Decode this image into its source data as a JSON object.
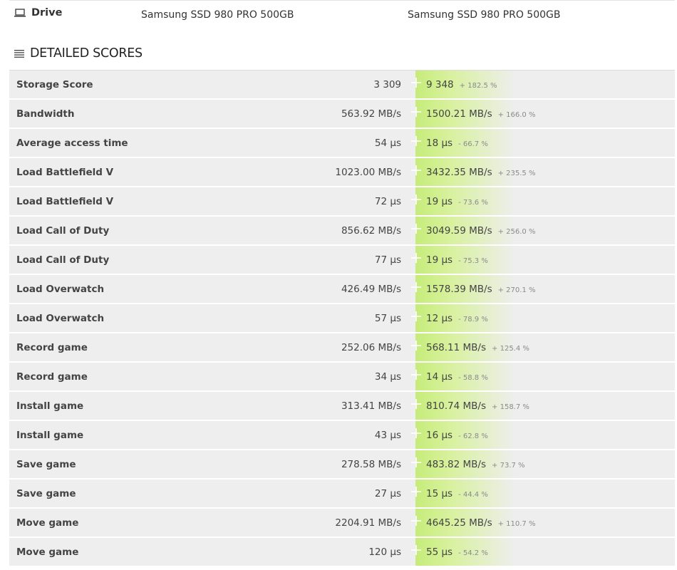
{
  "drive": {
    "label": "Drive",
    "icon": "laptop-icon",
    "left_name": "Samsung SSD 980 PRO 500GB",
    "right_name": "Samsung SSD 980 PRO 500GB"
  },
  "section": {
    "title": "DETAILED SCORES",
    "icon": "list-icon"
  },
  "colors": {
    "highlight_green": "#c6ec7a",
    "row_bg": "#eeeeee"
  },
  "rows": [
    {
      "label": "Storage Score",
      "left": "3 309",
      "right": "9 348",
      "diff": "+ 182.5 %"
    },
    {
      "label": "Bandwidth",
      "left": "563.92 MB/s",
      "right": "1500.21 MB/s",
      "diff": "+ 166.0 %"
    },
    {
      "label": "Average access time",
      "left": "54 µs",
      "right": "18 µs",
      "diff": "- 66.7 %"
    },
    {
      "label": "Load Battlefield V",
      "left": "1023.00 MB/s",
      "right": "3432.35 MB/s",
      "diff": "+ 235.5 %"
    },
    {
      "label": "Load Battlefield V",
      "left": "72 µs",
      "right": "19 µs",
      "diff": "- 73.6 %"
    },
    {
      "label": "Load Call of Duty",
      "left": "856.62 MB/s",
      "right": "3049.59 MB/s",
      "diff": "+ 256.0 %"
    },
    {
      "label": "Load Call of Duty",
      "left": "77 µs",
      "right": "19 µs",
      "diff": "- 75.3 %"
    },
    {
      "label": "Load Overwatch",
      "left": "426.49 MB/s",
      "right": "1578.39 MB/s",
      "diff": "+ 270.1 %"
    },
    {
      "label": "Load Overwatch",
      "left": "57 µs",
      "right": "12 µs",
      "diff": "- 78.9 %"
    },
    {
      "label": "Record game",
      "left": "252.06 MB/s",
      "right": "568.11 MB/s",
      "diff": "+ 125.4 %"
    },
    {
      "label": "Record game",
      "left": "34 µs",
      "right": "14 µs",
      "diff": "- 58.8 %"
    },
    {
      "label": "Install game",
      "left": "313.41 MB/s",
      "right": "810.74 MB/s",
      "diff": "+ 158.7 %"
    },
    {
      "label": "Install game",
      "left": "43 µs",
      "right": "16 µs",
      "diff": "- 62.8 %"
    },
    {
      "label": "Save game",
      "left": "278.58 MB/s",
      "right": "483.82 MB/s",
      "diff": "+ 73.7 %"
    },
    {
      "label": "Save game",
      "left": "27 µs",
      "right": "15 µs",
      "diff": "- 44.4 %"
    },
    {
      "label": "Move game",
      "left": "2204.91 MB/s",
      "right": "4645.25 MB/s",
      "diff": "+ 110.7 %"
    },
    {
      "label": "Move game",
      "left": "120 µs",
      "right": "55 µs",
      "diff": "- 54.2 %"
    }
  ]
}
